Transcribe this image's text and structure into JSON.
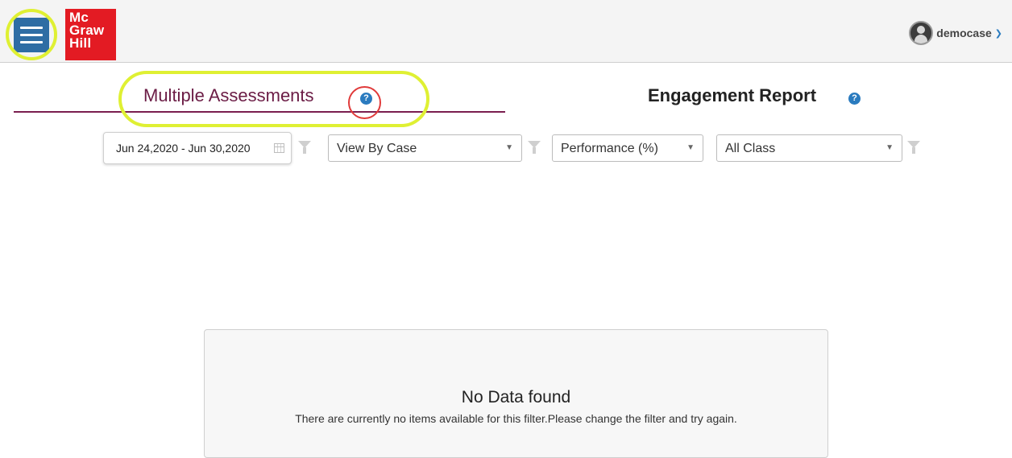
{
  "header": {
    "logo_lines": [
      "Mc",
      "Graw",
      "Hill"
    ],
    "username": "democase"
  },
  "tabs": {
    "multiple_assessments": "Multiple Assessments",
    "engagement_report": "Engagement Report",
    "help_glyph": "?"
  },
  "filters": {
    "date_range": "Jun 24,2020 - Jun 30,2020",
    "view_by": "View By Case",
    "metric": "Performance (%)",
    "class": "All Class"
  },
  "empty_state": {
    "title": "No Data found",
    "message": "There are currently no items available for this filter.Please change the filter and try again."
  },
  "colors": {
    "brand_red": "#e31b23",
    "menu_blue": "#2e6da4",
    "highlight_yellow": "#dff033",
    "tab_accent": "#7a1e4f",
    "help_blue": "#2a7bbf"
  }
}
